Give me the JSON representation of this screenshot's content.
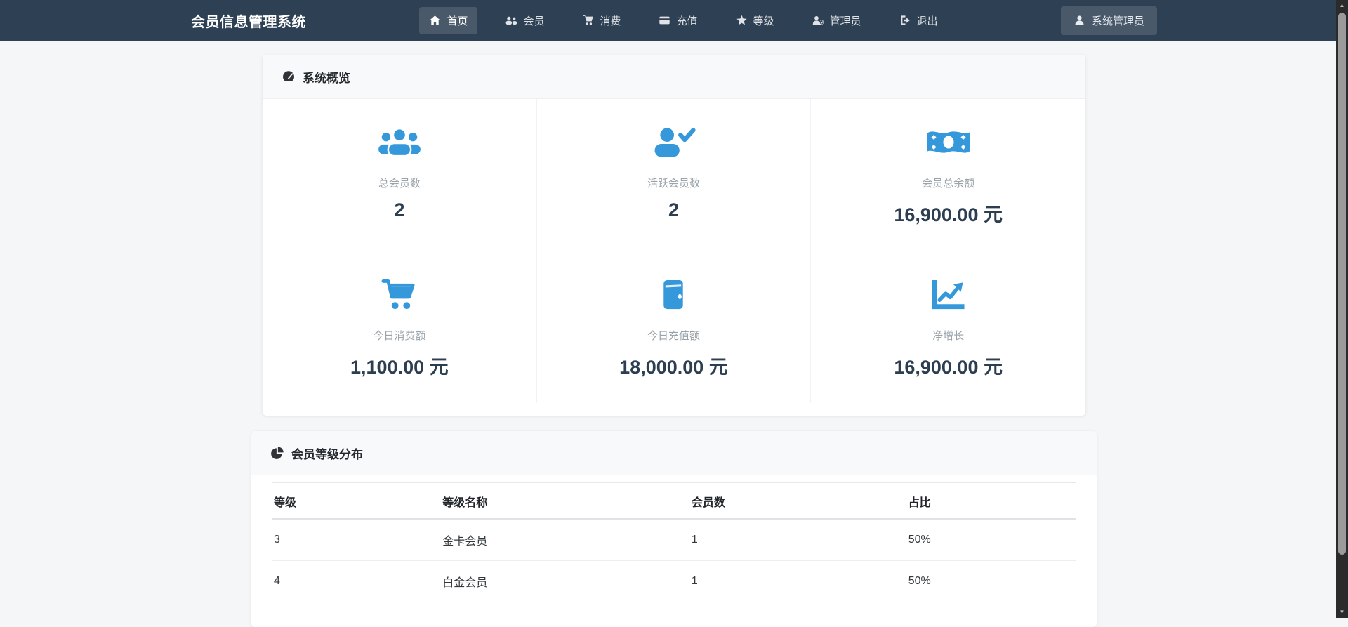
{
  "colors": {
    "accent": "#3498db",
    "navbar_bg": "#2e4154",
    "value_text": "#2c3e50",
    "page_bg": "#f5f6f7"
  },
  "navbar": {
    "brand": "会员信息管理系统",
    "items": [
      {
        "id": "home",
        "label": "首页",
        "icon": "i-home",
        "active": true
      },
      {
        "id": "members",
        "label": "会员",
        "icon": "i-users",
        "active": false
      },
      {
        "id": "consume",
        "label": "消费",
        "icon": "i-cart",
        "active": false
      },
      {
        "id": "recharge",
        "label": "充值",
        "icon": "i-card",
        "active": false
      },
      {
        "id": "level",
        "label": "等级",
        "icon": "i-star",
        "active": false
      },
      {
        "id": "admin",
        "label": "管理员",
        "icon": "i-user-gear",
        "active": false
      },
      {
        "id": "logout",
        "label": "退出",
        "icon": "i-logout",
        "active": false
      }
    ],
    "user_button": {
      "label": "系统管理员",
      "icon": "user-icon"
    }
  },
  "overview": {
    "title": "系统概览",
    "icon": "tachometer-icon",
    "stats": [
      {
        "label": "总会员数",
        "value": "2",
        "icon": "i-users-big",
        "icon_name": "users-group-icon"
      },
      {
        "label": "活跃会员数",
        "value": "2",
        "icon": "i-user-check",
        "icon_name": "user-check-icon"
      },
      {
        "label": "会员总余额",
        "value": "16,900.00 元",
        "icon": "i-money",
        "icon_name": "money-bill-icon"
      },
      {
        "label": "今日消费额",
        "value": "1,100.00 元",
        "icon": "i-cart-big",
        "icon_name": "shopping-cart-icon"
      },
      {
        "label": "今日充值额",
        "value": "18,000.00 元",
        "icon": "i-wallet",
        "icon_name": "wallet-icon"
      },
      {
        "label": "净增长",
        "value": "16,900.00 元",
        "icon": "i-chart",
        "icon_name": "chart-line-icon"
      }
    ]
  },
  "distribution": {
    "title": "会员等级分布",
    "icon": "pie-chart-icon",
    "table": {
      "headers": [
        "等级",
        "等级名称",
        "会员数",
        "占比"
      ],
      "rows": [
        [
          "3",
          "金卡会员",
          "1",
          "50%"
        ],
        [
          "4",
          "白金会员",
          "1",
          "50%"
        ]
      ]
    }
  },
  "scrollbar": {
    "up_glyph": "▲",
    "down_glyph": "▼"
  }
}
